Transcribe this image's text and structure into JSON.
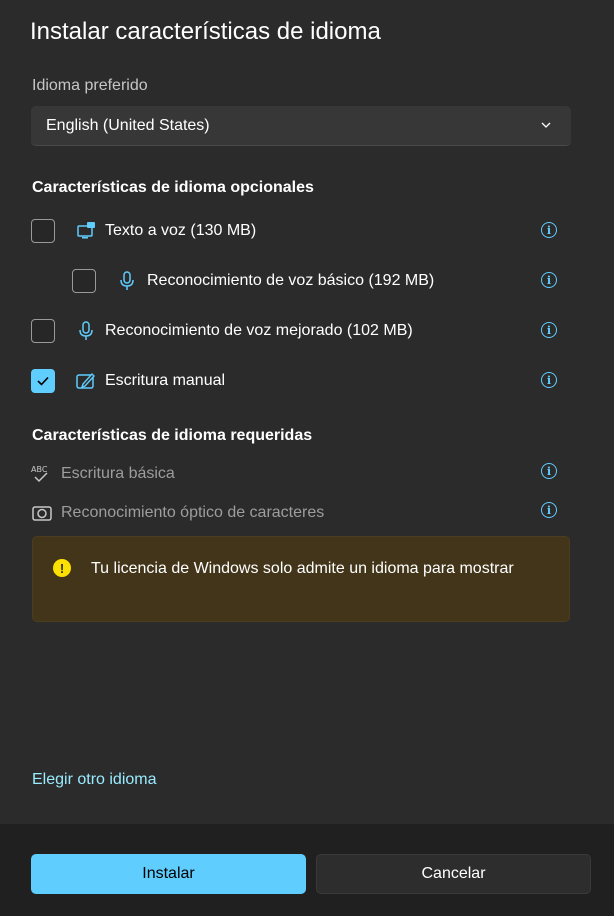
{
  "dialog": {
    "title": "Instalar características de idioma",
    "preferred_language_label": "Idioma preferido",
    "preferred_language_value": "English (United States)"
  },
  "optional": {
    "heading": "Características de idioma opcionales",
    "items": [
      {
        "label": "Texto a voz (130 MB)",
        "checked": false,
        "icon": "text-to-speech-icon"
      },
      {
        "label": "Reconocimiento de voz básico (192 MB)",
        "checked": false,
        "icon": "microphone-icon"
      },
      {
        "label": "Reconocimiento de voz mejorado (102 MB)",
        "checked": false,
        "icon": "microphone-icon"
      },
      {
        "label": "Escritura manual",
        "checked": true,
        "icon": "handwriting-icon"
      }
    ]
  },
  "required": {
    "heading": "Características de idioma requeridas",
    "items": [
      {
        "label": "Escritura básica",
        "icon": "spellcheck-icon"
      },
      {
        "label": "Reconocimiento óptico de caracteres",
        "icon": "camera-icon"
      }
    ]
  },
  "warning": {
    "message": "Tu licencia de Windows solo admite un idioma para mostrar"
  },
  "link": {
    "choose_other": "Elegir otro idioma"
  },
  "footer": {
    "install_label": "Instalar",
    "cancel_label": "Cancelar"
  },
  "colors": {
    "accent": "#60cdff",
    "background": "#2b2b2b",
    "footer": "#202020",
    "warning_bg": "#433519",
    "warning_icon": "#fce100"
  }
}
